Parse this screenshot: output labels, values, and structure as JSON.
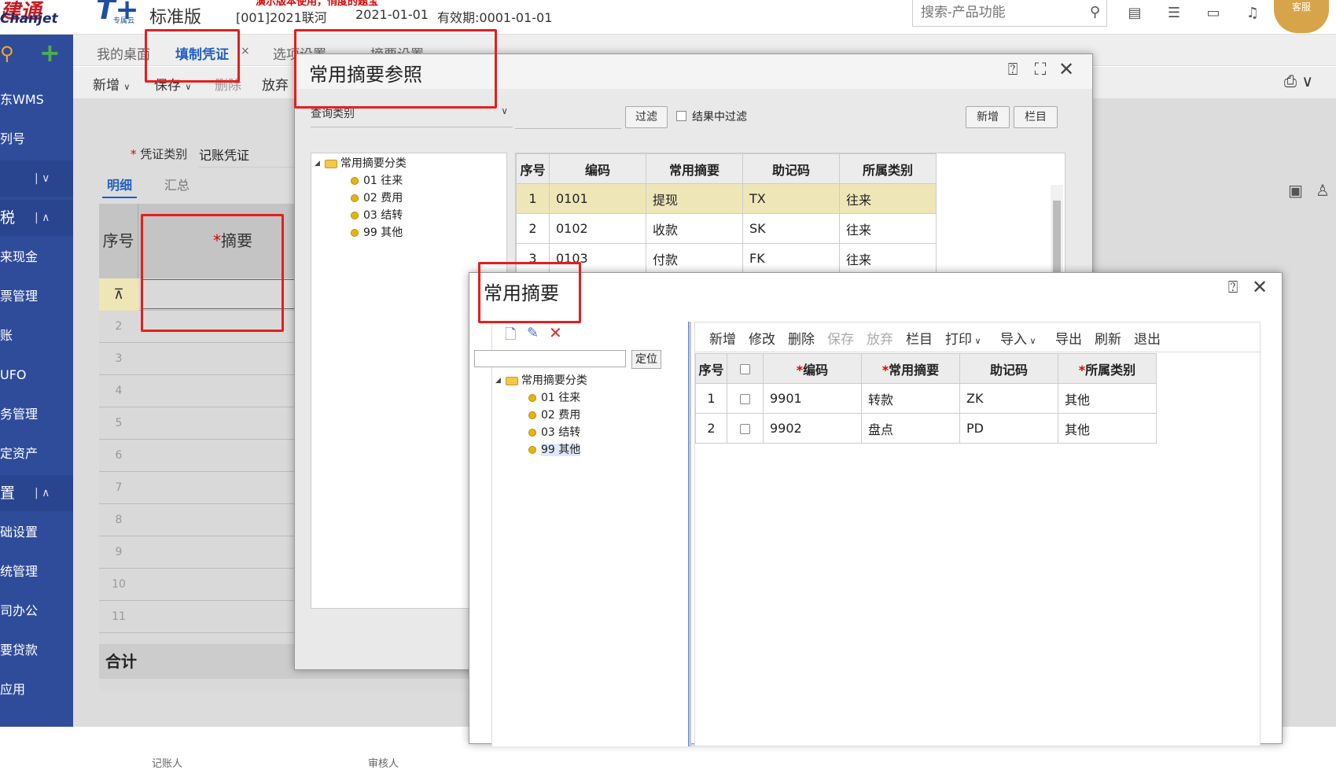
{
  "topbar": {
    "logo_cn": "建通",
    "logo_en": "Chanjet",
    "logo_t": "T+",
    "logo_sub": "专属云",
    "edition": "标准版",
    "promo": "演示版本使用，悄度的题宝",
    "account": "[001]2021联河",
    "date": "2021-01-01",
    "validity": "有效期:0001-01-01",
    "search_placeholder": "搜索-产品功能",
    "avatar_label": "客服"
  },
  "sidebar": {
    "items": [
      {
        "label": "东WMS"
      },
      {
        "label": "列号"
      },
      {
        "label": "|"
      },
      {
        "label": "税"
      },
      {
        "label": "来现金"
      },
      {
        "label": "票管理"
      },
      {
        "label": "账"
      },
      {
        "label": "UFO"
      },
      {
        "label": "务管理"
      },
      {
        "label": "定资产"
      },
      {
        "label": "置"
      },
      {
        "label": "础设置"
      },
      {
        "label": "统管理"
      },
      {
        "label": "司办公"
      },
      {
        "label": "要贷款"
      },
      {
        "label": "应用"
      }
    ]
  },
  "tabs": [
    "我的桌面",
    "填制凭证",
    "选项设置",
    "摘要设置"
  ],
  "toolbar": [
    "新增",
    "保存",
    "删除",
    "放弃"
  ],
  "voucher": {
    "type_label": "凭证类别",
    "type_value": "记账凭证",
    "subtab_detail": "明细",
    "subtab_summary": "汇总",
    "col_seq": "序号",
    "col_summary": "摘要",
    "rows": [
      "2",
      "3",
      "4",
      "5",
      "6",
      "7",
      "8",
      "9",
      "10",
      "11"
    ],
    "total": "合计",
    "bottom_left": "记账人",
    "bottom_right": "审核人"
  },
  "dialog1": {
    "title": "常用摘要参照",
    "query_label": "查询类别",
    "filter_btn": "过滤",
    "filter_in_results": "结果中过滤",
    "new_btn": "新增",
    "columns_btn": "栏目",
    "tree_root": "常用摘要分类",
    "tree_items": [
      "01 往来",
      "02 费用",
      "03 结转",
      "99 其他"
    ],
    "headers": [
      "序号",
      "编码",
      "常用摘要",
      "助记码",
      "所属类别"
    ],
    "rows": [
      [
        "1",
        "0101",
        "提现",
        "TX",
        "往来"
      ],
      [
        "2",
        "0102",
        "收款",
        "SK",
        "往来"
      ],
      [
        "3",
        "0103",
        "付款",
        "FK",
        "往来"
      ]
    ]
  },
  "dialog2": {
    "title": "常用摘要",
    "locate_btn": "定位",
    "tree_root": "常用摘要分类",
    "tree_items": [
      "01 往来",
      "02 费用",
      "03 结转",
      "99 其他"
    ],
    "toolbar": [
      "新增",
      "修改",
      "删除",
      "保存",
      "放弃",
      "栏目",
      "打印",
      "导入",
      "导出",
      "刷新",
      "退出"
    ],
    "headers": [
      "序号",
      "编码",
      "常用摘要",
      "助记码",
      "所属类别"
    ],
    "rows": [
      [
        "1",
        "9901",
        "转款",
        "ZK",
        "其他"
      ],
      [
        "2",
        "9902",
        "盘点",
        "PD",
        "其他"
      ]
    ]
  },
  "colors": {
    "sidebar": "#2f4c9a",
    "accent": "#1f5fbf",
    "highlight_box": "#e61e1e",
    "selected_row": "#efe6b8"
  }
}
